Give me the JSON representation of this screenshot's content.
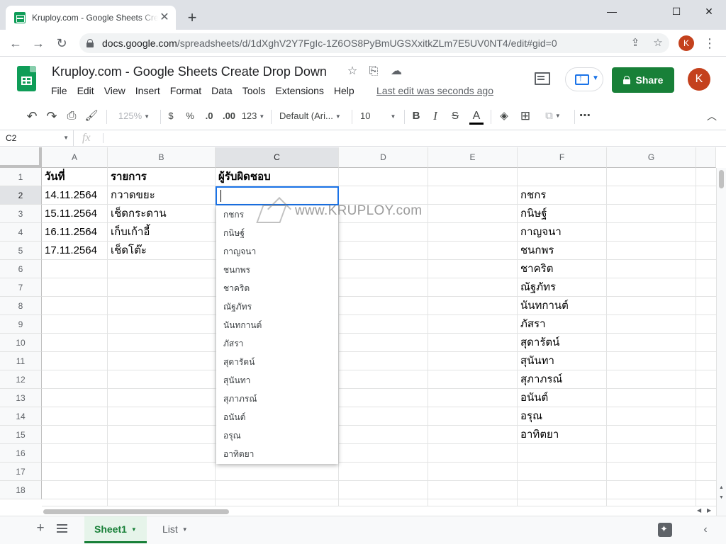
{
  "browser": {
    "tab_title": "Kruploy.com - Google Sheets Create Drop Down",
    "tab_close": "✕",
    "new_tab": "+",
    "window_controls": {
      "minimize": "—",
      "maximize": "☐",
      "close": "✕"
    },
    "url_domain": "docs.google.com",
    "url_path": "/spreadsheets/d/1dXghV2Y7FgIc-1Z6OS8PyBmUGSXxitkZLm7E5UV0NT4/edit#gid=0",
    "profile_initial": "K",
    "icons": {
      "back": "arrow-left-icon",
      "forward": "arrow-right-icon",
      "reload": "reload-icon",
      "share_page": "share-page-icon",
      "bookmark": "star-icon",
      "menu": "kebab-icon"
    }
  },
  "header": {
    "title": "Kruploy.com - Google Sheets Create Drop Down",
    "menu": [
      "File",
      "Edit",
      "View",
      "Insert",
      "Format",
      "Data",
      "Tools",
      "Extensions",
      "Help"
    ],
    "last_edit": "Last edit was seconds ago",
    "share_label": "Share",
    "avatar_initial": "K",
    "colors": {
      "share_green": "#188038",
      "avatar": "#c4411d",
      "sheets_green": "#0f9d58",
      "selection_blue": "#1a73e8"
    }
  },
  "toolbar": {
    "zoom": "125%",
    "currency": "$",
    "percent": "%",
    "decrease_decimal": ".0",
    "increase_decimal": ".00",
    "more_formats": "123",
    "font": "Default (Ari...",
    "font_size": "10",
    "bold": "B",
    "italic": "I",
    "strikethrough": "S",
    "text_color": "A"
  },
  "formula_bar": {
    "cell_ref": "C2",
    "fx": "fx",
    "value": ""
  },
  "grid": {
    "columns": [
      "A",
      "B",
      "C",
      "D",
      "E",
      "F",
      "G"
    ],
    "selected_column": "C",
    "rows": [
      "1",
      "2",
      "3",
      "4",
      "5",
      "6",
      "7",
      "8",
      "9",
      "10",
      "11",
      "12",
      "13",
      "14",
      "15",
      "16",
      "17",
      "18"
    ],
    "selected_row": "2",
    "headers": {
      "A": "วันที่",
      "B": "รายการ",
      "C": "ผู้รับผิดชอบ"
    },
    "data_rows": [
      {
        "date": "14.11.2564",
        "item": "กวาดขยะ"
      },
      {
        "date": "15.11.2564",
        "item": "เช็ดกระดาน"
      },
      {
        "date": "16.11.2564",
        "item": "เก็บเก้าอี้"
      },
      {
        "date": "17.11.2564",
        "item": "เช็ดโต๊ะ"
      }
    ],
    "names_column_f": [
      "กชกร",
      "กนิษฐ์",
      "กาญจนา",
      "ชนกพร",
      "ชาคริต",
      "ณัฐภัทร",
      "นันทกานต์",
      "ภัสรา",
      "สุดารัตน์",
      "สุนันทา",
      "สุภาภรณ์",
      "อนันต์",
      "อรุณ",
      "อาทิตยา"
    ]
  },
  "dropdown": {
    "options": [
      "กชกร",
      "กนิษฐ์",
      "กาญจนา",
      "ชนกพร",
      "ชาคริต",
      "ณัฐภัทร",
      "นันทกานต์",
      "ภัสรา",
      "สุดารัตน์",
      "สุนันทา",
      "สุภาภรณ์",
      "อนันต์",
      "อรุณ",
      "อาทิตยา"
    ]
  },
  "watermark": {
    "text": "www.KRUPLOY.com"
  },
  "sheet_tabs": {
    "add": "+",
    "tabs": [
      {
        "label": "Sheet1",
        "active": true
      },
      {
        "label": "List",
        "active": false
      }
    ],
    "collapse": "‹"
  }
}
